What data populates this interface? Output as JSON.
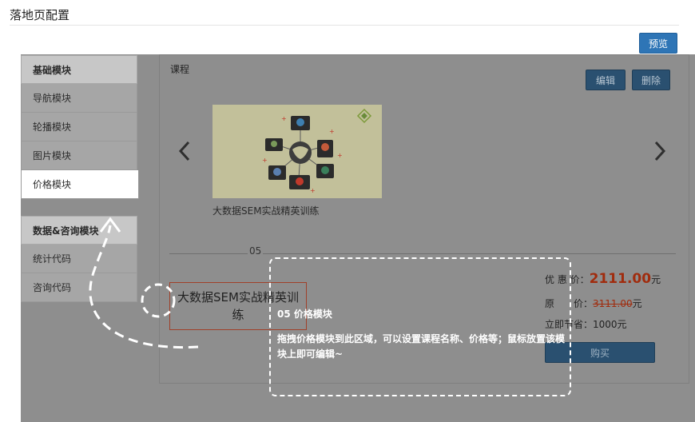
{
  "header": {
    "title": "落地页配置",
    "preview_label": "预览"
  },
  "sidebar": {
    "group1": {
      "title": "基础模块",
      "items": [
        {
          "label": "导航模块"
        },
        {
          "label": "轮播模块"
        },
        {
          "label": "图片模块"
        },
        {
          "label": "价格模块"
        }
      ]
    },
    "group2": {
      "title": "数据&咨询模块",
      "items": [
        {
          "label": "统计代码"
        },
        {
          "label": "咨询代码"
        }
      ]
    }
  },
  "course_panel": {
    "label": "课程",
    "edit_label": "编辑",
    "delete_label": "删除",
    "prev_icon": "chevron-left-icon",
    "next_icon": "chevron-right-icon",
    "course_caption": "大数据SEM实战精英训练",
    "index": "05"
  },
  "price_module": {
    "course_name": "大数据SEM实战精英训练",
    "discount_label": "优 惠 价：",
    "discount_value": "2111.00",
    "discount_unit": "元",
    "original_label": "原　　价：",
    "original_value": "3111.00",
    "original_unit": "元",
    "saving_label": "立即节省：",
    "saving_value": "1000元",
    "buy_label": "购买"
  },
  "hint": {
    "title": "05 价格模块",
    "body": "拖拽价格模块到此区域，可以设置课程名称、价格等；鼠标放置该模块上即可编辑~"
  },
  "colors": {
    "primary": "#2e75b6",
    "overlay": "#8e8e8e",
    "price": "#a02c0e"
  }
}
